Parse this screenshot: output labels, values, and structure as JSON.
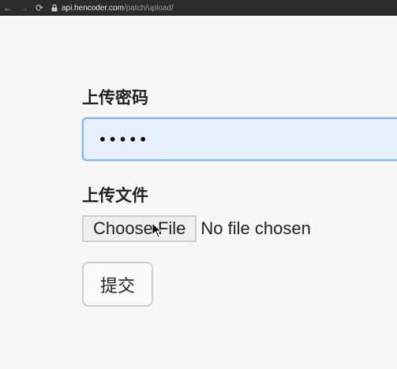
{
  "browser": {
    "url_host": "api.hencoder.com",
    "url_path": "/patch/upload/"
  },
  "form": {
    "password_label": "上传密码",
    "password_value": "•••••",
    "file_label": "上传文件",
    "choose_file_label": "Choose File",
    "no_file_text": "No file chosen",
    "submit_label": "提交"
  }
}
